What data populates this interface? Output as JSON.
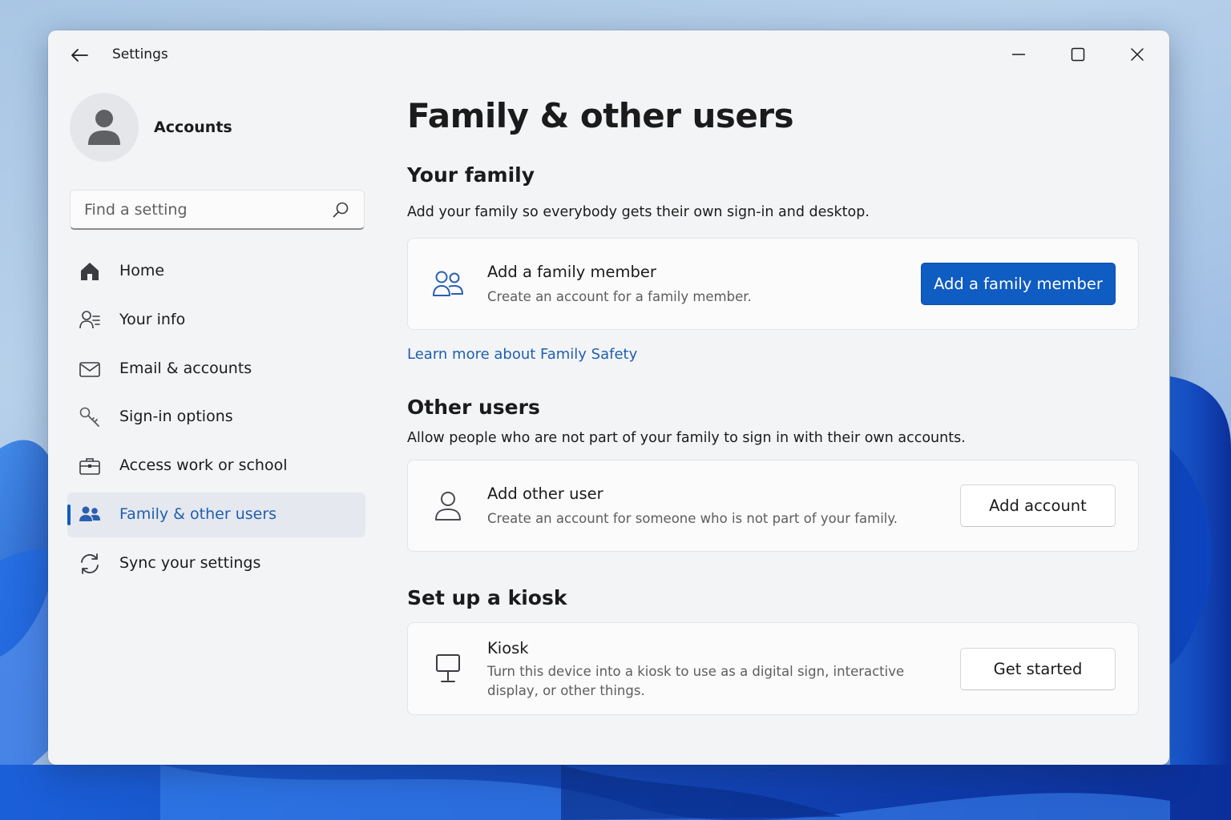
{
  "window": {
    "title": "Settings"
  },
  "profile": {
    "label": "Accounts"
  },
  "search": {
    "placeholder": "Find a setting"
  },
  "nav": {
    "items": [
      {
        "label": "Home",
        "icon": "home-icon"
      },
      {
        "label": "Your info",
        "icon": "person-icon"
      },
      {
        "label": "Email & accounts",
        "icon": "mail-icon"
      },
      {
        "label": "Sign-in options",
        "icon": "key-icon"
      },
      {
        "label": "Access work or school",
        "icon": "briefcase-icon"
      },
      {
        "label": "Family & other users",
        "icon": "family-icon",
        "selected": true
      },
      {
        "label": "Sync your settings",
        "icon": "sync-icon"
      }
    ]
  },
  "main": {
    "title": "Family & other users",
    "your_family": {
      "heading": "Your family",
      "description": "Add your family so everybody gets their own sign-in and desktop.",
      "card": {
        "title": "Add a family member",
        "description": "Create an account for a family member.",
        "button": "Add a family member"
      },
      "link": "Learn more about Family Safety"
    },
    "other_users": {
      "heading": "Other users",
      "description": "Allow people who are not part of your family to sign in with their own accounts.",
      "card": {
        "title": "Add other user",
        "description": "Create an account for someone who is not part of your family.",
        "button": "Add account"
      }
    },
    "kiosk": {
      "heading": "Set up a kiosk",
      "card": {
        "title": "Kiosk",
        "description_line1": "Turn this device into a kiosk to use as a digital sign, interactive",
        "description_line2": "display, or other things.",
        "button": "Get started"
      }
    }
  },
  "colors": {
    "accent": "#0f5cc2",
    "link": "#1f5fb0",
    "window_bg": "#f3f4f6",
    "card_bg": "#fbfbfc"
  }
}
